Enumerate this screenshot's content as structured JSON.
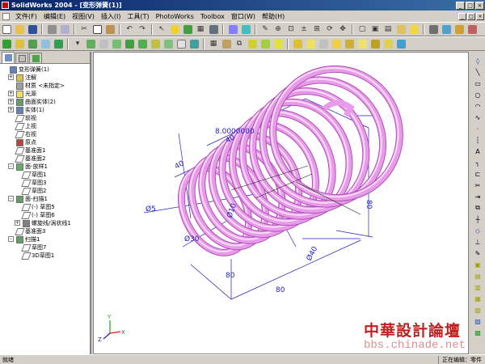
{
  "window": {
    "title": "SolidWorks 2004 - [变形弹簧(1)]",
    "min": "_",
    "max": "□",
    "close": "×"
  },
  "menu": {
    "items": [
      "文件(F)",
      "编辑(E)",
      "视图(V)",
      "插入(I)",
      "工具(T)",
      "PhotoWorks",
      "Toolbox",
      "窗口(W)",
      "帮助(H)"
    ]
  },
  "tree": {
    "items": [
      {
        "label": "变形弹簧(1)",
        "depth": 0,
        "icon": "part-icon",
        "expand": ""
      },
      {
        "label": "注解",
        "depth": 1,
        "icon": "annotation-icon",
        "expand": "+"
      },
      {
        "label": "材质 <未指定>",
        "depth": 1,
        "icon": "material-icon",
        "expand": ""
      },
      {
        "label": "光源",
        "depth": 1,
        "icon": "lights-icon",
        "expand": "+"
      },
      {
        "label": "曲面实体(2)",
        "depth": 1,
        "icon": "surface-bodies-icon",
        "expand": "+"
      },
      {
        "label": "实体(1)",
        "depth": 1,
        "icon": "solid-bodies-icon",
        "expand": "+"
      },
      {
        "label": "前视",
        "depth": 1,
        "icon": "plane-icon",
        "expand": ""
      },
      {
        "label": "上视",
        "depth": 1,
        "icon": "plane-icon",
        "expand": ""
      },
      {
        "label": "右视",
        "depth": 1,
        "icon": "plane-icon",
        "expand": ""
      },
      {
        "label": "原点",
        "depth": 1,
        "icon": "origin-icon",
        "expand": ""
      },
      {
        "label": "基准面1",
        "depth": 1,
        "icon": "plane-icon",
        "expand": ""
      },
      {
        "label": "基准面2",
        "depth": 1,
        "icon": "plane-icon",
        "expand": ""
      },
      {
        "label": "面-放样1",
        "depth": 1,
        "icon": "loft-icon",
        "expand": "-"
      },
      {
        "label": "草图1",
        "depth": 2,
        "icon": "sketch-icon",
        "expand": ""
      },
      {
        "label": "草图3",
        "depth": 2,
        "icon": "sketch-icon",
        "expand": ""
      },
      {
        "label": "草图2",
        "depth": 2,
        "icon": "sketch-icon",
        "expand": ""
      },
      {
        "label": "面-扫描1",
        "depth": 1,
        "icon": "sweep-icon",
        "expand": "-"
      },
      {
        "label": "(-) 草图5",
        "depth": 2,
        "icon": "sketch-icon",
        "expand": ""
      },
      {
        "label": "(-) 草图6",
        "depth": 2,
        "icon": "sketch-icon",
        "expand": ""
      },
      {
        "label": "螺旋线/涡状线1",
        "depth": 2,
        "icon": "helix-icon",
        "expand": "+"
      },
      {
        "label": "基准面3",
        "depth": 1,
        "icon": "plane-icon",
        "expand": ""
      },
      {
        "label": "扫描1",
        "depth": 1,
        "icon": "sweep-icon",
        "expand": "-"
      },
      {
        "label": "草图7",
        "depth": 2,
        "icon": "sketch-icon",
        "expand": ""
      },
      {
        "label": "3D草图1",
        "depth": 2,
        "icon": "sketch-3d-icon",
        "expand": ""
      }
    ]
  },
  "viewport": {
    "dimensions": {
      "d8": "8.0000000",
      "d40_top": "40",
      "d40_side": "40",
      "dia5": "Ø5",
      "d80_right": "80",
      "dia30": "Ø30",
      "dia40": "Ø40",
      "d80_bottom_a": "80",
      "d80_bottom_b": "80",
      "dia10": "Ø10"
    },
    "triad": {
      "x": "X",
      "y": "Y",
      "z": "Z"
    },
    "colors": {
      "spring": "#e89be8",
      "spring_dark": "#b050b8",
      "dimension": "#2020c0"
    }
  },
  "status": {
    "left": "就绪",
    "right": "正在编辑：零件"
  },
  "watermark": {
    "text": "中華設計論壇",
    "url": "bbs.chinade.net"
  }
}
